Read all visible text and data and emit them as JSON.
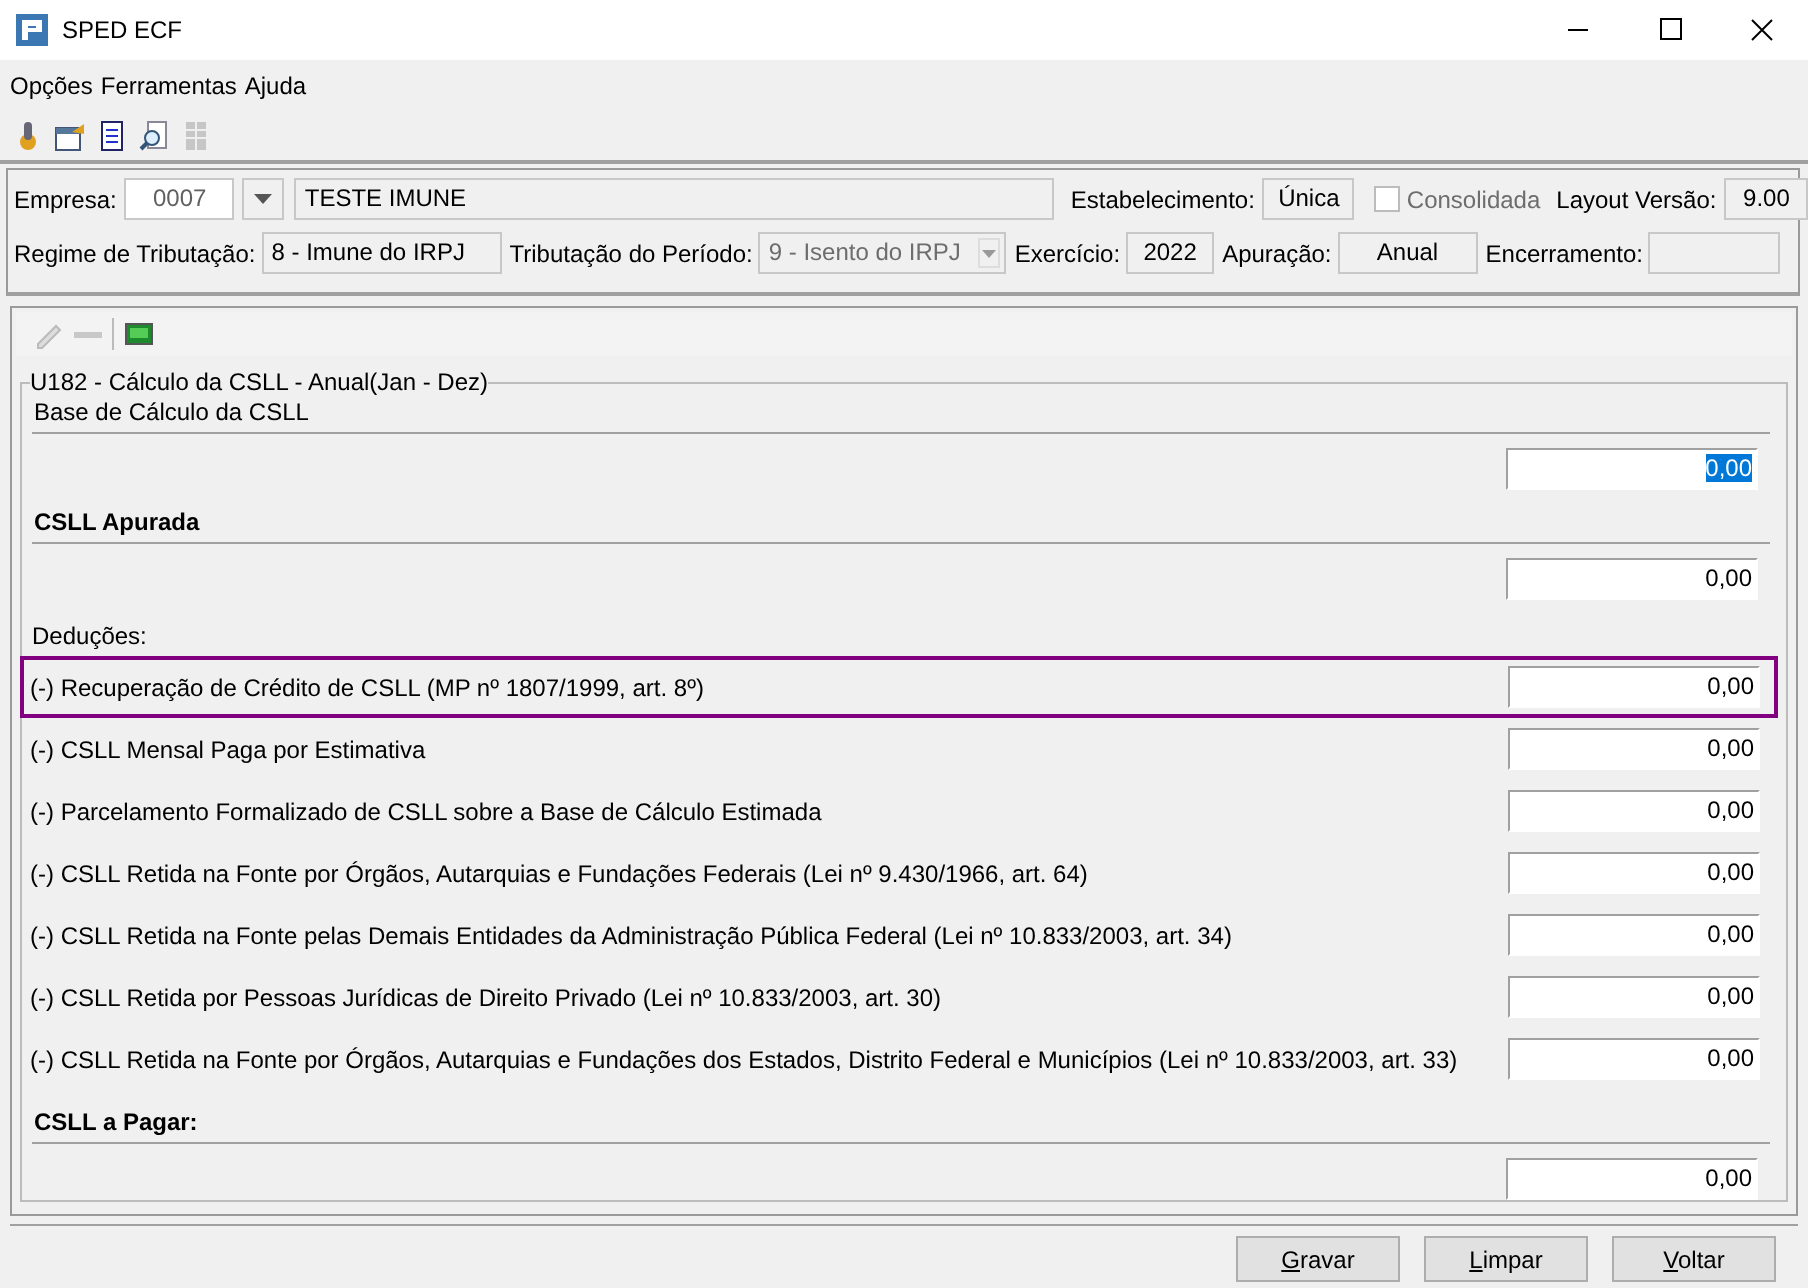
{
  "window": {
    "title": "SPED ECF"
  },
  "menu": [
    "Opções",
    "Ferramentas",
    "Ajuda"
  ],
  "toolbar": [
    {
      "disabled": false
    },
    {
      "disabled": false
    },
    {
      "disabled": false
    },
    {
      "disabled": false
    },
    {
      "disabled": true
    }
  ],
  "header": {
    "row1": [
      {
        "kind": "label",
        "text": "Empresa:"
      },
      {
        "kind": "code",
        "value": "0007"
      },
      {
        "kind": "dropbutton"
      },
      {
        "kind": "field",
        "value": "TESTE IMUNE"
      },
      {
        "kind": "label",
        "text": "Estabelecimento:"
      },
      {
        "kind": "field",
        "value": "Única"
      },
      {
        "kind": "checkbox",
        "label": "Consolidada",
        "checked": false,
        "disabled": true
      },
      {
        "kind": "label",
        "text": "Layout Versão:"
      },
      {
        "kind": "field",
        "value": "9.00"
      }
    ],
    "row2": [
      {
        "kind": "label",
        "text": "Regime de Tributação:"
      },
      {
        "kind": "field",
        "value": "8 - Imune do IRPJ"
      },
      {
        "kind": "label",
        "text": "Tributação do Período:"
      },
      {
        "kind": "combo",
        "value": "9 - Isento do IRPJ",
        "disabled": true
      },
      {
        "kind": "label",
        "text": "Exercício:"
      },
      {
        "kind": "field",
        "value": "2022"
      },
      {
        "kind": "label",
        "text": "Apuração:"
      },
      {
        "kind": "field",
        "value": "Anual"
      },
      {
        "kind": "label",
        "text": "Encerramento:"
      },
      {
        "kind": "field"
      }
    ]
  },
  "form": {
    "title": "U182 - Cálculo da CSLL - Anual(Jan - Dez)",
    "items": [
      {
        "kind": "section",
        "label": "Base de Cálculo da CSLL",
        "bold": false,
        "value": "0,00",
        "selected": true
      },
      {
        "kind": "section",
        "label": "CSLL Apurada",
        "bold": true,
        "value": "0,00",
        "selected": false
      },
      {
        "kind": "group",
        "label": "Deduções:"
      },
      {
        "kind": "line",
        "label": "(-) Recuperação de Crédito de CSLL (MP nº 1807/1999, art. 8º)",
        "value": "0,00",
        "highlighted": true
      },
      {
        "kind": "line",
        "label": "(-) CSLL Mensal Paga por Estimativa",
        "value": "0,00",
        "highlighted": false
      },
      {
        "kind": "line",
        "label": "(-) Parcelamento Formalizado de CSLL sobre a Base de Cálculo Estimada",
        "value": "0,00",
        "highlighted": false
      },
      {
        "kind": "line",
        "label": "(-) CSLL Retida na Fonte por Órgãos, Autarquias e Fundações Federais (Lei nº 9.430/1966, art. 64)",
        "value": "0,00",
        "highlighted": false
      },
      {
        "kind": "line",
        "label": "(-) CSLL Retida na Fonte pelas Demais Entidades da Administração Pública Federal (Lei nº 10.833/2003, art. 34)",
        "value": "0,00",
        "highlighted": false
      },
      {
        "kind": "line",
        "label": "(-) CSLL Retida por Pessoas Jurídicas de Direito Privado (Lei nº 10.833/2003, art. 30)",
        "value": "0,00",
        "highlighted": false
      },
      {
        "kind": "line",
        "label": "(-) CSLL Retida na Fonte por Órgãos, Autarquias e Fundações dos Estados, Distrito Federal e Municípios (Lei nº 10.833/2003, art. 33)",
        "value": "0,00",
        "highlighted": false
      },
      {
        "kind": "section",
        "label": "CSLL a Pagar:",
        "bold": true,
        "value": "0,00",
        "selected": false
      }
    ]
  },
  "buttons": [
    "Gravar",
    "Limpar",
    "Voltar"
  ]
}
